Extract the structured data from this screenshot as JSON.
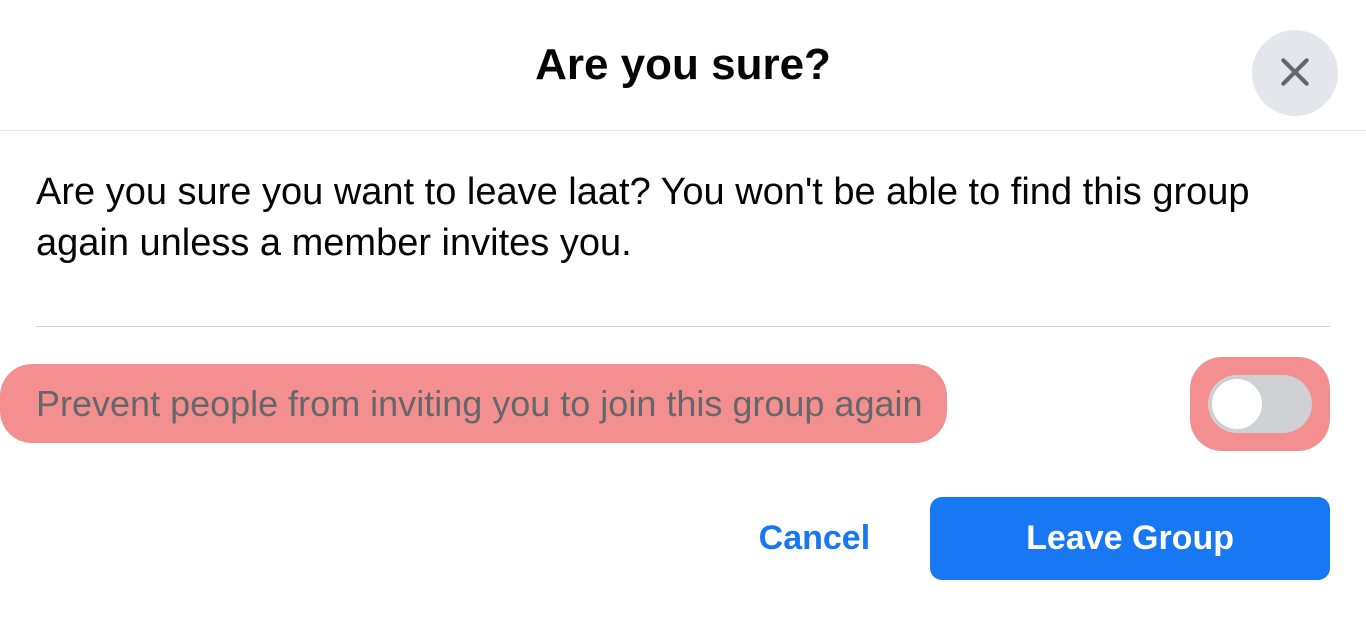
{
  "dialog": {
    "title": "Are you sure?",
    "message": "Are you sure you want to leave laat? You won't be able to find this group again unless a member invites you.",
    "option": {
      "label": "Prevent people from inviting you to join this group again",
      "toggled": false
    },
    "footer": {
      "cancel_label": "Cancel",
      "leave_label": "Leave Group"
    }
  },
  "colors": {
    "primary": "#1877f2",
    "highlight": "#f38f8f",
    "close_bg": "#e4e6eb",
    "toggle_off": "#ced0d4"
  }
}
